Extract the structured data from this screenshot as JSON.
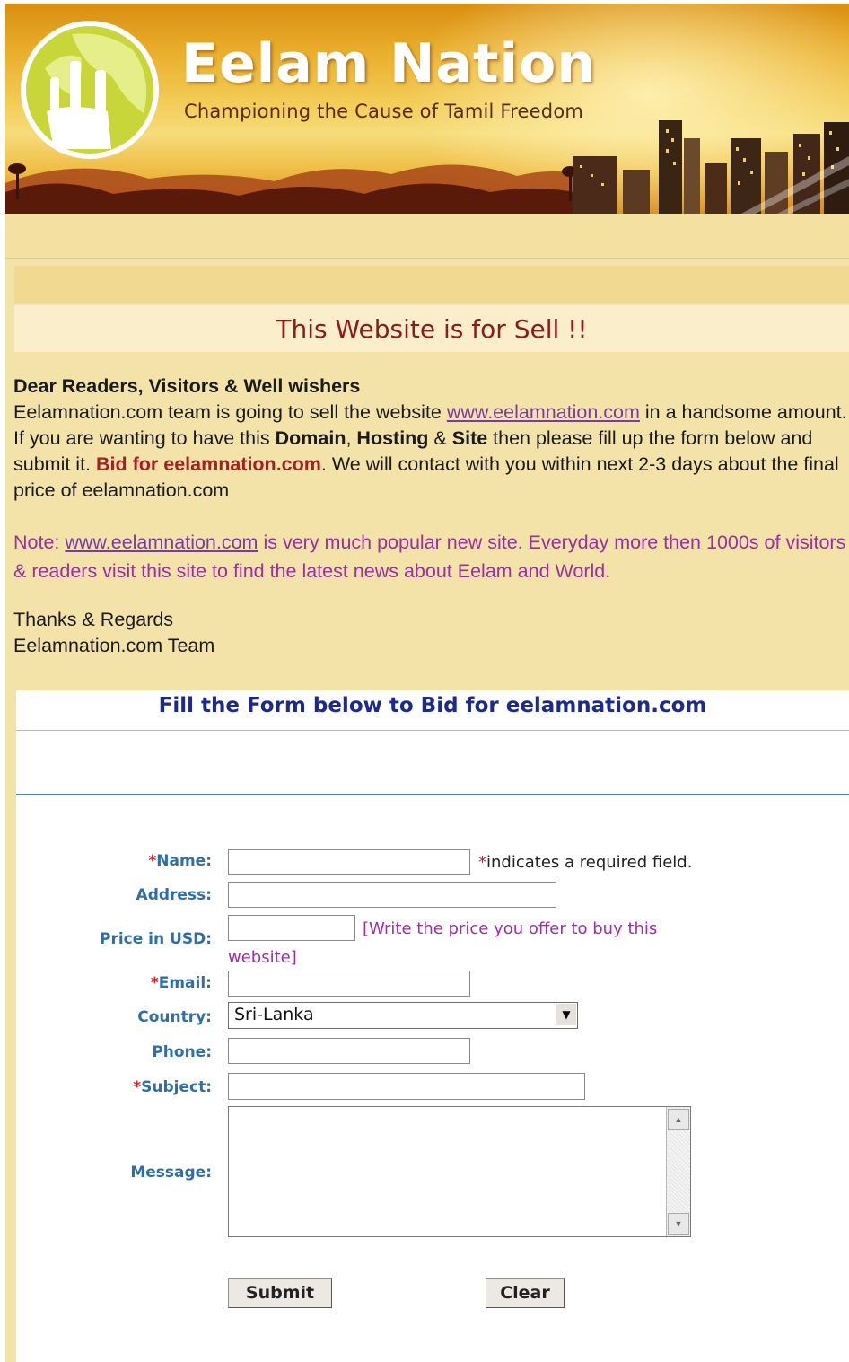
{
  "header": {
    "site_title": "Eelam Nation",
    "tagline": "Championing the Cause of Tamil Freedom",
    "logo_icon": "raised-hands-globe-icon"
  },
  "banner": {
    "heading": "This Website is for Sell !!"
  },
  "letter": {
    "greeting": "Dear Readers, Visitors & Well wishers",
    "p1_a": "Eelamnation.com team is going to sell the website ",
    "p1_link": "www.eelamnation.com",
    "p1_b": " in a handsome amount. If you are wanting to have this ",
    "p1_domain": "Domain",
    "p1_c": ", ",
    "p1_hosting": "Hosting",
    "p1_d": " & ",
    "p1_site": "Site",
    "p1_e": " then please fill up the form below and submit it. ",
    "p1_bid": "Bid for eelamnation.com",
    "p1_f": ". We will contact with you within next 2-3 days about the final price of eelamnation.com",
    "note_a": "Note: ",
    "note_link": "www.eelamnation.com",
    "note_b": " is very much popular new site. Everyday more then 1000s of visitors & readers visit this site to find the latest news about Eelam and World.",
    "thanks": "Thanks & Regards",
    "team": "Eelamnation.com Team"
  },
  "form": {
    "title": "Fill the Form below to Bid for eelamnation.com",
    "required_mark": "*",
    "required_note": "indicates a required field.",
    "labels": {
      "name": "Name:",
      "address": "Address:",
      "price": "Price in USD:",
      "email": "Email:",
      "country": "Country:",
      "phone": "Phone:",
      "subject": "Subject:",
      "message": "Message:"
    },
    "price_hint_1": "[Write the price you offer to buy this",
    "price_hint_2": "website]",
    "country_value": "Sri-Lanka",
    "submit_label": "Submit",
    "clear_label": "Clear"
  },
  "colors": {
    "page_bg": "#f4e3a8",
    "title_red": "#8e1b1b",
    "form_title_blue": "#1c2a8c",
    "label_blue": "#2d6fae",
    "note_purple": "#9b2fa3",
    "required_red": "#d02020"
  }
}
